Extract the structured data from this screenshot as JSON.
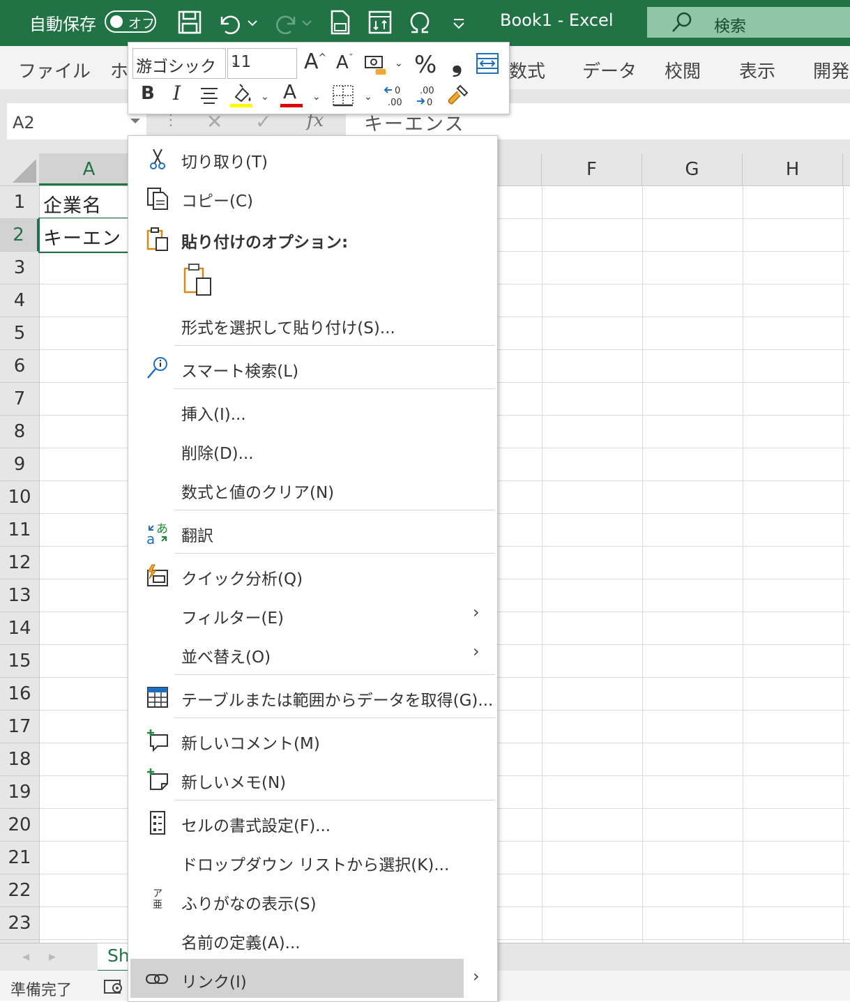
{
  "app": {
    "autosave_label": "自動保存",
    "autosave_state": "オフ",
    "title": "Book1  -  Excel",
    "search_label": "検索",
    "accent_color": "#217346"
  },
  "ribbon": {
    "tabs": [
      "ファイル",
      "ホ",
      "数式",
      "データ",
      "校閲",
      "表示",
      "開発"
    ]
  },
  "formula_bar": {
    "name_box": "A2",
    "fx_label": "fx",
    "content": "キーエンス"
  },
  "grid": {
    "col_headers": [
      "A",
      "F",
      "G",
      "H"
    ],
    "row_headers": [
      "1",
      "2",
      "3",
      "4",
      "5",
      "6",
      "7",
      "8",
      "9",
      "10",
      "11",
      "12",
      "13",
      "14",
      "15",
      "16",
      "17",
      "18",
      "19",
      "20",
      "21",
      "22",
      "23"
    ],
    "cells": {
      "A1": "企業名",
      "A2": "キーエン"
    },
    "selected_cell": "A2"
  },
  "mini_toolbar": {
    "font_name": "游ゴシック",
    "font_size": "11",
    "bold": "B",
    "italic": "I",
    "percent": "%",
    "comma": "❟",
    "font_color_letter": "A",
    "increase_font": "A",
    "decrease_font": "A"
  },
  "context_menu": {
    "items": [
      {
        "label": "切り取り(T)",
        "icon": "scissors-icon"
      },
      {
        "label": "コピー(C)",
        "icon": "copy-icon"
      },
      {
        "label": "貼り付けのオプション:",
        "icon": "paste-options-icon"
      },
      {
        "label": "形式を選択して貼り付け(S)...",
        "icon": ""
      },
      {
        "label": "スマート検索(L)",
        "icon": "smart-lookup-icon"
      },
      {
        "label": "挿入(I)...",
        "icon": ""
      },
      {
        "label": "削除(D)...",
        "icon": ""
      },
      {
        "label": "数式と値のクリア(N)",
        "icon": ""
      },
      {
        "label": "翻訳",
        "icon": "translate-icon"
      },
      {
        "label": "クイック分析(Q)",
        "icon": "quick-analysis-icon"
      },
      {
        "label": "フィルター(E)",
        "icon": ""
      },
      {
        "label": "並べ替え(O)",
        "icon": ""
      },
      {
        "label": "テーブルまたは範囲からデータを取得(G)...",
        "icon": "table-icon"
      },
      {
        "label": "新しいコメント(M)",
        "icon": "new-comment-icon"
      },
      {
        "label": "新しいメモ(N)",
        "icon": "new-note-icon"
      },
      {
        "label": "セルの書式設定(F)...",
        "icon": "format-cells-icon"
      },
      {
        "label": "ドロップダウン リストから選択(K)...",
        "icon": ""
      },
      {
        "label": "ふりがなの表示(S)",
        "icon": "furigana-icon"
      },
      {
        "label": "名前の定義(A)...",
        "icon": ""
      },
      {
        "label": "リンク(I)",
        "icon": "link-icon"
      }
    ],
    "submenu_arrow": "›",
    "furigana_glyph_top": "ア",
    "furigana_glyph_bottom": "亜"
  },
  "sheet": {
    "tab_label": "Sh",
    "status": "準備完了"
  }
}
